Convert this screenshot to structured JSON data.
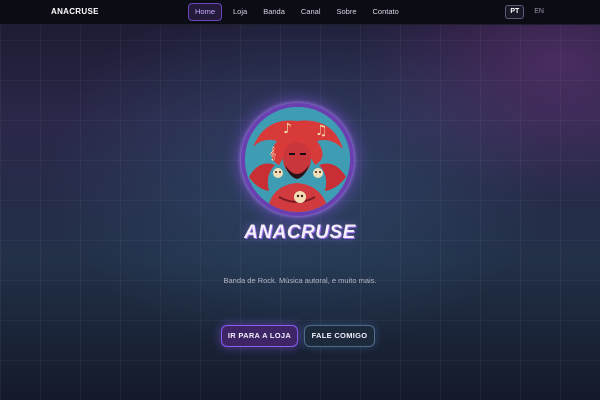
{
  "nav": {
    "brand": "ANACRUSE",
    "items": [
      {
        "label": "Home",
        "active": true
      },
      {
        "label": "Loja"
      },
      {
        "label": "Banda"
      },
      {
        "label": "Canal"
      },
      {
        "label": "Sobre"
      },
      {
        "label": "Contato"
      }
    ],
    "languages": [
      {
        "label": "PT",
        "active": true
      },
      {
        "label": "EN"
      }
    ]
  },
  "hero": {
    "title": "ANACRUSE",
    "tagline": "Banda de Rock. Música autoral, e muito mais.",
    "primary_button": "IR PARA A LOJA",
    "secondary_button": "FALE COMIGO"
  },
  "colors": {
    "accent": "#8a5cf0",
    "nav_background": "#0c0c14",
    "avatar_ring": "#6a3fb0"
  },
  "icons": {
    "avatar": "band-logo-illustration"
  }
}
